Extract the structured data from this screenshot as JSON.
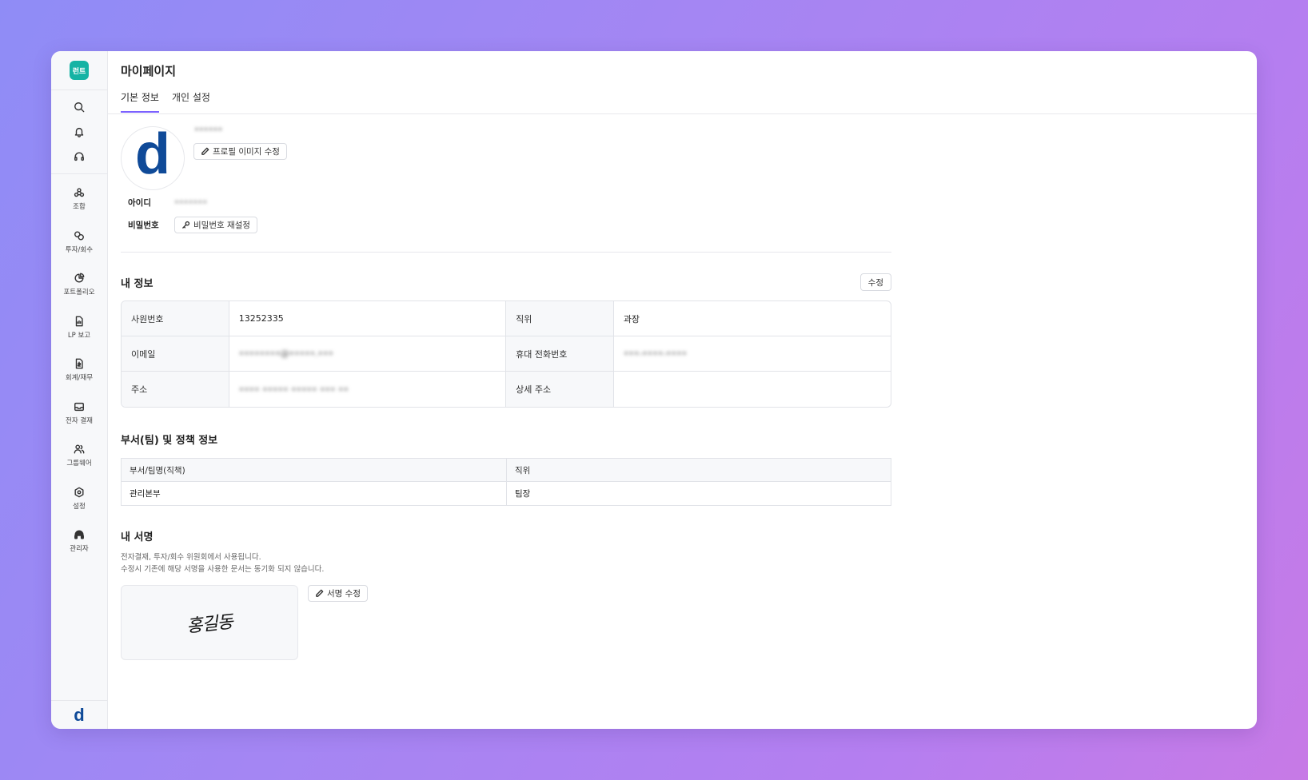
{
  "sidebar": {
    "logo_badge": "런트",
    "top_icons": [
      "search-icon",
      "bell-icon",
      "headset-icon"
    ],
    "items": [
      {
        "label": "조합",
        "icon": "union-icon"
      },
      {
        "label": "투자/회수",
        "icon": "investment-icon"
      },
      {
        "label": "포트폴리오",
        "icon": "portfolio-icon"
      },
      {
        "label": "LP 보고",
        "icon": "report-icon"
      },
      {
        "label": "회계/재무",
        "icon": "accounting-icon"
      },
      {
        "label": "전자 결재",
        "icon": "approval-icon"
      },
      {
        "label": "그룹웨어",
        "icon": "groupware-icon"
      },
      {
        "label": "설정",
        "icon": "settings-icon"
      },
      {
        "label": "관리자",
        "icon": "admin-icon"
      }
    ],
    "bottom_logo": "d"
  },
  "header": {
    "title": "마이페이지",
    "tabs": [
      {
        "label": "기본 정보",
        "active": true
      },
      {
        "label": "개인 설정",
        "active": false
      }
    ]
  },
  "profile": {
    "avatar_letter": "d",
    "username": "••••••",
    "edit_image_label": "프로필 이미지 수정",
    "id_label": "아이디",
    "id_value": "•••••••",
    "password_label": "비밀번호",
    "reset_password_label": "비밀번호 재설정"
  },
  "my_info": {
    "title": "내 정보",
    "edit_label": "수정",
    "rows": [
      {
        "l1": "사원번호",
        "v1": "13252335",
        "l2": "직위",
        "v2": "과장"
      },
      {
        "l1": "이메일",
        "v1": "••••••••@•••••.•••",
        "l2": "휴대 전화번호",
        "v2": "•••-••••-••••"
      },
      {
        "l1": "주소",
        "v1": "•••• ••••• ••••• ••• ••",
        "l2": "상세 주소",
        "v2": ""
      }
    ]
  },
  "dept": {
    "title": "부서(팀) 및 정책 정보",
    "headers": [
      "부서/팀명(직책)",
      "직위"
    ],
    "row": [
      "관리본부",
      "팀장"
    ]
  },
  "signature": {
    "title": "내 서명",
    "desc1": "전자결재, 투자/회수 위원회에서 사용됩니다.",
    "desc2": "수정시 기존에 해당 서명을 사용한 문서는 동기화 되지 않습니다.",
    "sign_text": "홍길동",
    "edit_label": "서명 수정"
  },
  "colors": {
    "accent": "#7b61ff",
    "brand_teal": "#15b3a4",
    "brand_blue": "#0f4a98"
  }
}
